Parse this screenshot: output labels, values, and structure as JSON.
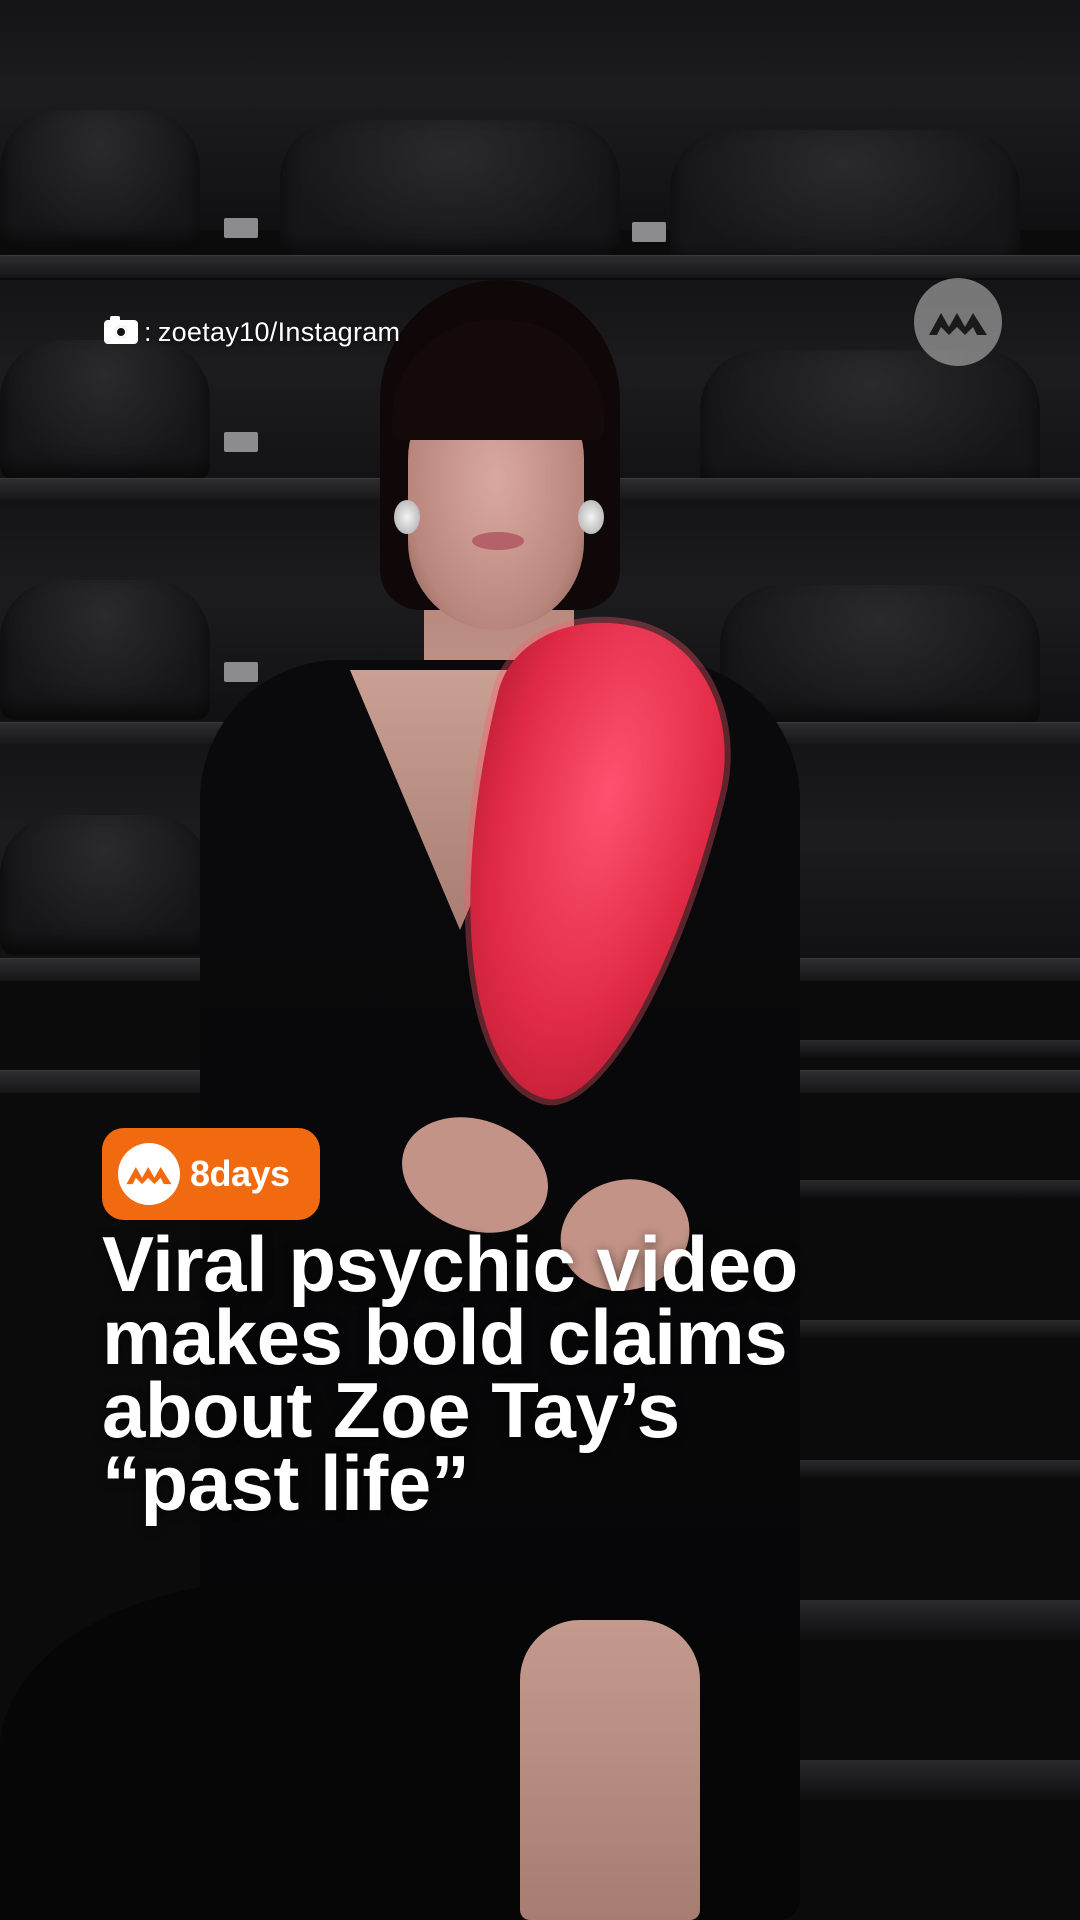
{
  "photo_credit": {
    "icon": "camera-icon",
    "separator": ":",
    "handle": "zoetay10/Instagram"
  },
  "publisher_logo": {
    "icon": "mediacorp-logo-icon"
  },
  "brand_badge": {
    "icon": "mediacorp-mark-icon",
    "label": "8days",
    "color": "#f26a0f"
  },
  "headline": {
    "lines": [
      "Viral psychic video",
      "makes bold claims",
      "about Zoe Tay’s",
      "“past life”"
    ]
  },
  "photo": {
    "dress_accent_color": "#e02a45"
  }
}
